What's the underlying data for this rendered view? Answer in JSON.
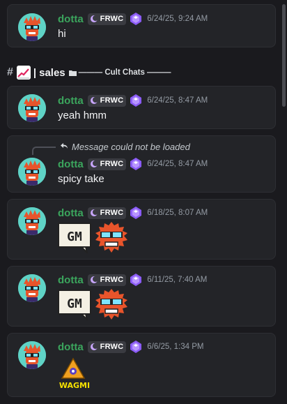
{
  "messages": [
    {
      "author": "dotta",
      "tag": "FRWC",
      "timestamp": "6/24/25, 9:24 AM",
      "text": "hi"
    },
    {
      "author": "dotta",
      "tag": "FRWC",
      "timestamp": "6/24/25, 8:47 AM",
      "text": "yeah hmm"
    },
    {
      "author": "dotta",
      "tag": "FRWC",
      "timestamp": "6/24/25, 8:47 AM",
      "text": "spicy take",
      "reply_preview": "Message could not be loaded"
    },
    {
      "author": "dotta",
      "tag": "FRWC",
      "timestamp": "6/18/25, 8:07 AM",
      "stickers": [
        "gm-sticker",
        "fuzzy-sunglasses-sticker"
      ]
    },
    {
      "author": "dotta",
      "tag": "FRWC",
      "timestamp": "6/11/25, 7:40 AM",
      "stickers": [
        "gm-sticker",
        "fuzzy-sunglasses-sticker"
      ]
    },
    {
      "author": "dotta",
      "tag": "FRWC",
      "timestamp": "6/6/25, 1:34 PM",
      "stickers": [
        "wagmi-sticker"
      ]
    }
  ],
  "channel_header": {
    "hash_icon": "#",
    "emoji": "chart-increasing-emoji",
    "separator": "|",
    "channel_name": "sales",
    "category": "——— Cult Chats ———"
  },
  "stickers": {
    "gm_text": "GM",
    "wagmi_text": "WAGMI"
  },
  "colors": {
    "background": "#1a1a1e",
    "card": "#232428",
    "author": "#3ba55d",
    "timestamp": "#949ba4"
  }
}
